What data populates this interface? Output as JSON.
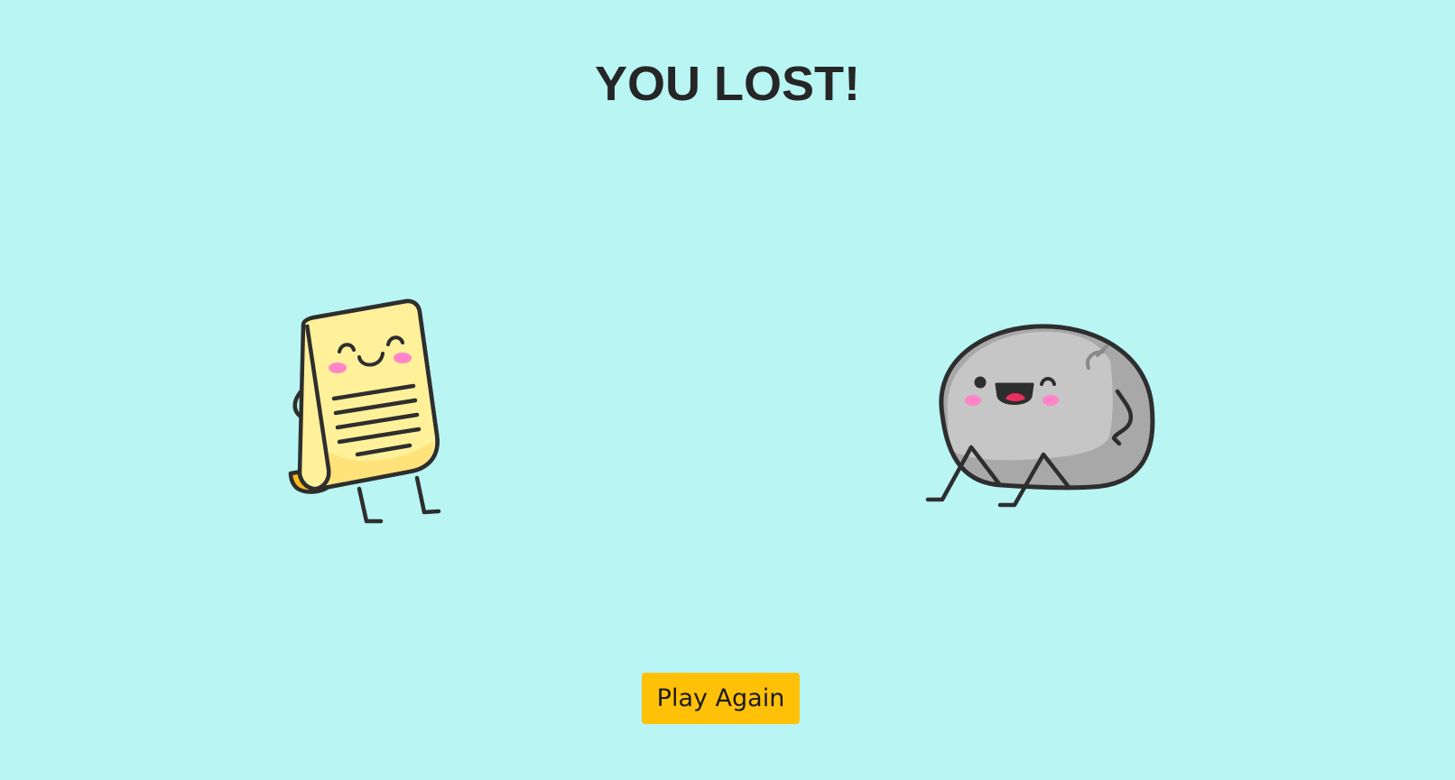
{
  "screen": {
    "title": "YOU LOST!",
    "play_again_label": "Play Again",
    "background_color": "#b8f5f3",
    "button_color": "#ffc107"
  },
  "player_choice": {
    "name": "paper",
    "icon": "paper-character-icon"
  },
  "opponent_choice": {
    "name": "rock",
    "icon": "rock-character-icon"
  }
}
